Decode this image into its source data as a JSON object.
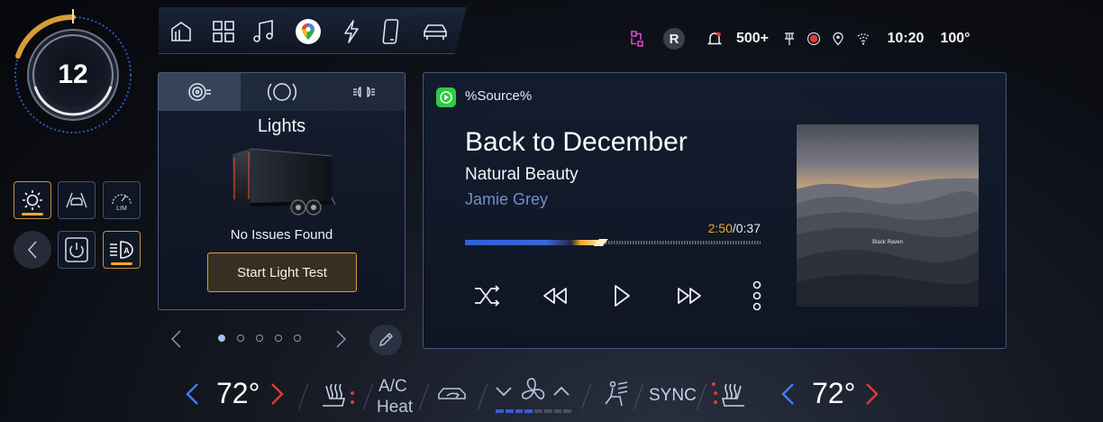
{
  "gauge": {
    "value": "12"
  },
  "nav": {
    "icons": [
      "home-icon",
      "apps-grid-icon",
      "music-icon",
      "maps-icon",
      "energy-icon",
      "phone-icon",
      "vehicle-icon"
    ],
    "accent": "#3b6fd1"
  },
  "status": {
    "gear": "R",
    "notifications": "500+",
    "time": "10:20",
    "outside_temp": "100°"
  },
  "left_controls": {
    "items": [
      "exterior-light-icon",
      "driver-assist-icon",
      "speed-limit-icon",
      "back-icon",
      "power-icon",
      "auto-headlight-icon"
    ],
    "active_color": "#f0a92a"
  },
  "lights": {
    "tabs": [
      "tire-icon",
      "brake-icon",
      "headlight-icon"
    ],
    "title": "Lights",
    "status": "No Issues Found",
    "button": "Start Light Test"
  },
  "pager": {
    "count": 5,
    "active": 0
  },
  "media": {
    "source": "%Source%",
    "song": "Back to December",
    "album": "Natural Beauty",
    "artist": "Jamie Grey",
    "elapsed": "2:50",
    "total": "/0:37",
    "progress": 0.46,
    "album_art_text": "Black Raven",
    "controls": [
      "shuffle-icon",
      "rewind-icon",
      "play-icon",
      "fast-forward-icon",
      "more-icon"
    ]
  },
  "climate": {
    "driver_temp": "72°",
    "passenger_temp": "72°",
    "ac_line1": "A/C",
    "ac_line2": "Heat",
    "sync": "SYNC",
    "fan_level": 4,
    "fan_max": 8
  }
}
